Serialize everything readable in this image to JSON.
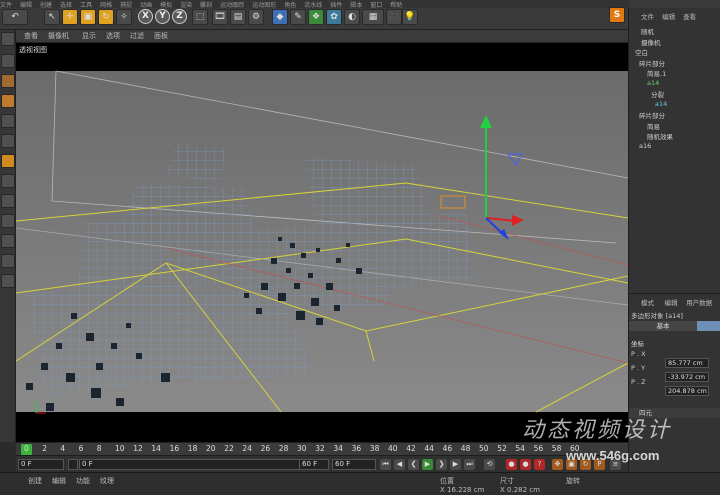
{
  "menu": {
    "items": [
      "文件",
      "编辑",
      "创建",
      "选择",
      "工具",
      "网格",
      "捕捉",
      "动画",
      "模拟",
      "渲染",
      "雕刻",
      "运动跟踪",
      "运动图形",
      "角色",
      "流水线",
      "插件",
      "脚本",
      "窗口",
      "帮助"
    ]
  },
  "toolbar": {
    "undo_glyph": "↶",
    "axis_x": "X",
    "axis_y": "Y",
    "axis_z": "Z"
  },
  "viewport": {
    "menu": [
      "查看",
      "摄像机",
      "显示",
      "选项",
      "过滤",
      "面板"
    ],
    "label": "透视视图"
  },
  "object_manager": {
    "tabs": [
      "文件",
      "编辑",
      "查看"
    ],
    "items": [
      {
        "label": "随机",
        "style": "plain"
      },
      {
        "label": "摄像机",
        "style": "plain"
      },
      {
        "label": "空白",
        "style": "plain"
      },
      {
        "label": "碎片部分",
        "style": "plain"
      },
      {
        "label": "简易.1",
        "style": "plain"
      },
      {
        "label": "a14",
        "style": "green"
      },
      {
        "label": "分裂",
        "style": "plain"
      },
      {
        "label": "a14",
        "style": "cyan"
      },
      {
        "label": "碎片部分",
        "style": "plain"
      },
      {
        "label": "简易",
        "style": "plain"
      },
      {
        "label": "随机效果",
        "style": "plain"
      },
      {
        "label": "a16",
        "style": "plain"
      }
    ]
  },
  "attributes": {
    "tabs": [
      "模式",
      "编辑",
      "用户数据"
    ],
    "object_label": "多边形对象 [a14]",
    "subtab": "基本",
    "section": "坐标",
    "coords": [
      {
        "axis": "P . X",
        "value": "85.777 cm"
      },
      {
        "axis": "P . Y",
        "value": "-33.972 cm"
      },
      {
        "axis": "P . Z",
        "value": "204.878 cm"
      }
    ],
    "quaternion": "四元"
  },
  "timeline": {
    "ticks": [
      "0",
      "2",
      "4",
      "6",
      "8",
      "10",
      "12",
      "14",
      "16",
      "18",
      "20",
      "22",
      "24",
      "26",
      "28",
      "30",
      "32",
      "34",
      "36",
      "38",
      "40",
      "42",
      "44",
      "46",
      "48",
      "50",
      "52",
      "54",
      "56",
      "58",
      "60"
    ],
    "current_frame": "0"
  },
  "transport": {
    "start": "0 F",
    "preview_start": "0 F",
    "preview_end": "60 F",
    "end": "60 F"
  },
  "bottom_bar": {
    "material_tabs": [
      "创建",
      "编辑",
      "功能",
      "纹理"
    ],
    "coord_headers": [
      "位置",
      "尺寸",
      "旋转"
    ],
    "pos_x": "X  16.228 cm",
    "size_x": "X  0.282 cm"
  },
  "watermark": {
    "text": "动态视频设计",
    "url": "www.546g.com"
  },
  "colors": {
    "accent_orange": "#f0a020",
    "grid_blue": "#6e8fb8",
    "axis_yellow": "#d8d23a"
  }
}
